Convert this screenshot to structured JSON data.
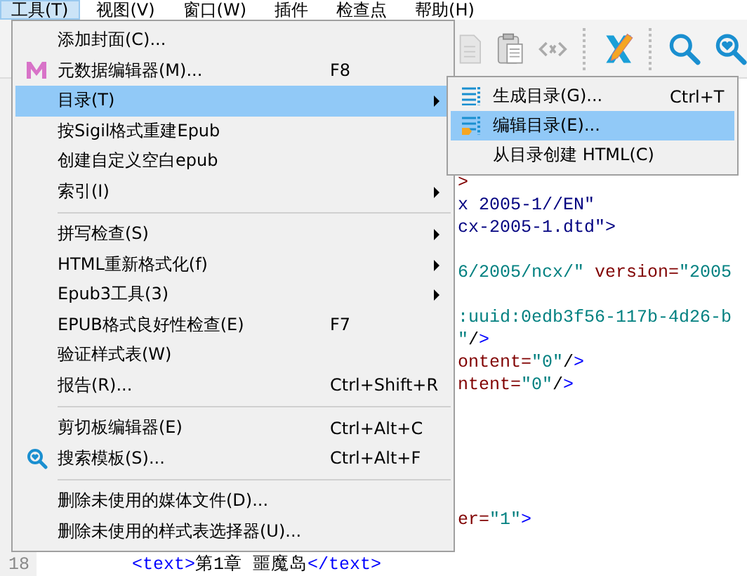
{
  "menu_bar": [
    {
      "label": "工具(T)",
      "selected": true
    },
    {
      "label": "视图(V)",
      "selected": false
    },
    {
      "label": "窗口(W)",
      "selected": false
    },
    {
      "label": "插件",
      "selected": false
    },
    {
      "label": "检查点",
      "selected": false
    },
    {
      "label": "帮助(H)",
      "selected": false
    }
  ],
  "tools_menu": [
    {
      "kind": "item",
      "label": "添加封面(C)...",
      "selected": false,
      "has_submenu": false
    },
    {
      "kind": "item",
      "label": "元数据编辑器(M)...",
      "shortcut": "F8",
      "selected": false,
      "has_submenu": false
    },
    {
      "kind": "item",
      "label": "目录(T)",
      "selected": true,
      "has_submenu": true
    },
    {
      "kind": "item",
      "label": "按Sigil格式重建Epub",
      "selected": false,
      "has_submenu": false
    },
    {
      "kind": "item",
      "label": "创建自定义空白epub",
      "selected": false,
      "has_submenu": false
    },
    {
      "kind": "item",
      "label": "索引(I)",
      "selected": false,
      "has_submenu": true
    },
    {
      "kind": "separator"
    },
    {
      "kind": "item",
      "label": "拼写检查(S)",
      "selected": false,
      "has_submenu": true
    },
    {
      "kind": "item",
      "label": "HTML重新格式化(f)",
      "selected": false,
      "has_submenu": true
    },
    {
      "kind": "item",
      "label": "Epub3工具(3)",
      "selected": false,
      "has_submenu": true
    },
    {
      "kind": "item",
      "label": "EPUB格式良好性检查(E)",
      "shortcut": "F7",
      "selected": false,
      "has_submenu": false
    },
    {
      "kind": "item",
      "label": "验证样式表(W)",
      "selected": false,
      "has_submenu": false
    },
    {
      "kind": "item",
      "label": "报告(R)...",
      "shortcut": "Ctrl+Shift+R",
      "selected": false,
      "has_submenu": false
    },
    {
      "kind": "separator"
    },
    {
      "kind": "item",
      "label": "剪切板编辑器(E)",
      "shortcut": "Ctrl+Alt+C",
      "selected": false,
      "has_submenu": false
    },
    {
      "kind": "item",
      "label": "搜索模板(S)...",
      "shortcut": "Ctrl+Alt+F",
      "selected": false,
      "has_submenu": false
    },
    {
      "kind": "separator"
    },
    {
      "kind": "item",
      "label": "删除未使用的媒体文件(D)...",
      "selected": false,
      "has_submenu": false
    },
    {
      "kind": "item",
      "label": "删除未使用的样式表选择器(U)...",
      "selected": false,
      "has_submenu": false
    }
  ],
  "toc_submenu": [
    {
      "label": "生成目录(G)...",
      "shortcut": "Ctrl+T",
      "selected": false
    },
    {
      "label": "编辑目录(E)...",
      "selected": true
    },
    {
      "label": "从目录创建 HTML(C)",
      "selected": false
    }
  ],
  "code_lines": [
    {
      "kind": "partial",
      "segments": [
        {
          "kind": "attr",
          "text": ">"
        }
      ]
    },
    {
      "kind": "partial",
      "segments": [
        {
          "kind": "doctype",
          "text": "x 2005-1//EN\""
        }
      ]
    },
    {
      "kind": "partial",
      "segments": [
        {
          "kind": "doctype",
          "text": "cx-2005-1.dtd\">"
        }
      ]
    },
    {
      "kind": "blank"
    },
    {
      "kind": "partial",
      "segments": [
        {
          "kind": "value",
          "text": "6/2005/ncx/\""
        },
        {
          "kind": "attr",
          "text": " version="
        },
        {
          "kind": "value",
          "text": "\"2005"
        }
      ]
    },
    {
      "kind": "blank"
    },
    {
      "kind": "partial",
      "segments": [
        {
          "kind": "value",
          "text": ":uuid:0edb3f56-117b-4d26-b"
        }
      ]
    },
    {
      "kind": "partial",
      "segments": [
        {
          "kind": "value",
          "text": "\""
        },
        {
          "kind": "plain",
          "text": "/"
        },
        {
          "kind": "tag",
          "text": ">"
        }
      ]
    },
    {
      "kind": "partial",
      "segments": [
        {
          "kind": "attr",
          "text": "ontent="
        },
        {
          "kind": "value",
          "text": "\"0\""
        },
        {
          "kind": "plain",
          "text": "/"
        },
        {
          "kind": "tag",
          "text": ">"
        }
      ]
    },
    {
      "kind": "partial",
      "segments": [
        {
          "kind": "attr",
          "text": "ntent="
        },
        {
          "kind": "value",
          "text": "\"0\""
        },
        {
          "kind": "plain",
          "text": "/"
        },
        {
          "kind": "tag",
          "text": ">"
        }
      ]
    },
    {
      "kind": "blank"
    },
    {
      "kind": "blank"
    },
    {
      "kind": "blank"
    },
    {
      "kind": "blank"
    },
    {
      "kind": "blank"
    },
    {
      "kind": "partial",
      "segments": [
        {
          "kind": "attr",
          "text": "er="
        },
        {
          "kind": "value",
          "text": "\"1\""
        },
        {
          "kind": "tag",
          "text": ">"
        }
      ]
    },
    {
      "kind": "blank"
    },
    {
      "kind": "full",
      "number": "18",
      "segments": [
        {
          "kind": "tag",
          "text": "<text>"
        },
        {
          "kind": "plain",
          "text": "第1章 噩魔岛"
        },
        {
          "kind": "tag",
          "text": "</text>"
        }
      ]
    }
  ]
}
